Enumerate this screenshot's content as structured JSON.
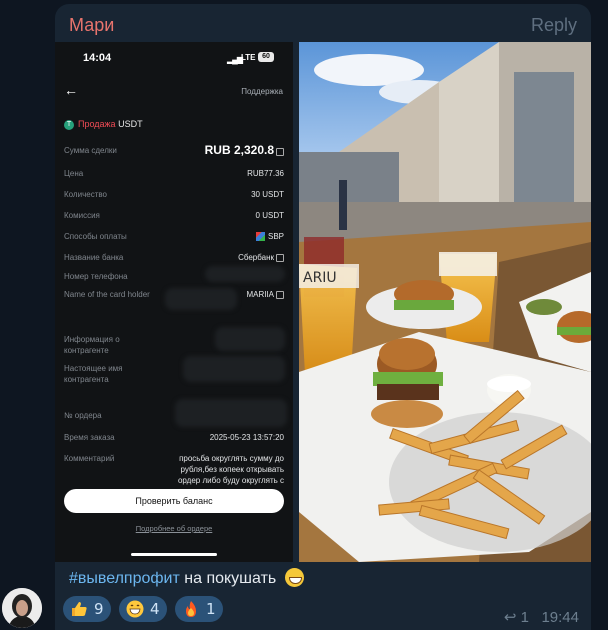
{
  "message": {
    "sender": "Мари",
    "reply_label": "Reply",
    "caption_hashtag": "#вывелпрофит",
    "caption_text": " на покушать",
    "reply_count": "1",
    "time": "19:44",
    "reactions": [
      {
        "emoji": "thumbs-up",
        "count": "9"
      },
      {
        "emoji": "grinning-face",
        "count": "4"
      },
      {
        "emoji": "fire",
        "count": "1"
      }
    ]
  },
  "phone": {
    "time": "14:04",
    "network": "LTE",
    "battery": "60",
    "support": "Поддержка",
    "title_prefix": "Продажа",
    "title_asset": "USDT",
    "rows": [
      {
        "label": "Сумма сделки",
        "value": "RUB 2,320.8"
      },
      {
        "label": "Цена",
        "value": "RUB77.36"
      },
      {
        "label": "Количество",
        "value": "30 USDT"
      },
      {
        "label": "Комиссия",
        "value": "0 USDT"
      },
      {
        "label": "Способы оплаты",
        "value": "SBP"
      },
      {
        "label": "Название банка",
        "value": "Сбербанк"
      },
      {
        "label": "Номер телефона",
        "value": ""
      },
      {
        "label": "Name of the card holder",
        "value": "MARIIA"
      },
      {
        "label": "Информация о контрагенте",
        "value": ""
      },
      {
        "label": "Настоящее имя контрагента",
        "value": ""
      },
      {
        "label": "№ ордера",
        "value": ""
      },
      {
        "label": "Время заказа",
        "value": "2025-05-23 13:57:20"
      },
      {
        "label": "Комментарий",
        "value": "просьба округлять сумму до рубля,без копеек открывать ордер либо буду округлять с мою"
      }
    ],
    "check_balance": "Проверить баланс",
    "order_details": "Подробнее об ордере"
  },
  "photo": {
    "sign_text": "ARIU"
  },
  "colors": {
    "bubble": "#182533",
    "sender": "#e8746d",
    "hashtag": "#6cb6ef",
    "reaction_bg": "#2b5278",
    "sell": "#ef4b55"
  }
}
